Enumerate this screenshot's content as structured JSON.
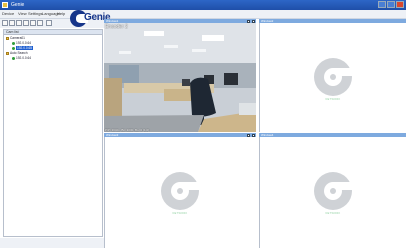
{
  "window": {
    "title": "Genie",
    "controls": [
      "minimize-icon",
      "maximize-icon",
      "close-icon"
    ]
  },
  "menu": {
    "items": [
      "Device",
      "View",
      "Settings",
      "Language",
      "Help"
    ]
  },
  "brand": {
    "logo_text": "Genie",
    "color": "#16358a"
  },
  "toolbar": {
    "buttons": [
      "layout-1-icon",
      "layout-4-icon",
      "layout-9-icon",
      "layout-16-icon",
      "record-icon",
      "snapshot-icon",
      "settings-icon"
    ]
  },
  "camera_list": {
    "header": "Cam list",
    "nodes": [
      {
        "label": "Camera01",
        "type": "folder",
        "level": 0
      },
      {
        "label": "192.0.0.64",
        "type": "camera",
        "level": 1
      },
      {
        "label": "192.0.0.65",
        "type": "camera",
        "level": 1,
        "selected": true
      },
      {
        "label": "Auto Search",
        "type": "folder",
        "level": 0
      },
      {
        "label": "192.0.0.64",
        "type": "camera",
        "level": 1
      }
    ]
  },
  "tiles": [
    {
      "caption": "Window1",
      "osd_title": "Encoder 2",
      "osd_info": "PIP=1640x, Bit=1000, Bo=0 (1.0)",
      "live": true
    },
    {
      "caption": "Window2",
      "live": false,
      "watermark": "NETWORK"
    },
    {
      "caption": "Window3",
      "live": false,
      "watermark": "NETWORK"
    },
    {
      "caption": "Window4",
      "live": false,
      "watermark": "NETWORK"
    }
  ],
  "colors": {
    "titlebar": "#2d66c6",
    "tile_caption": "#7eaadf",
    "placeholder_logo": "#cfd2d6"
  }
}
